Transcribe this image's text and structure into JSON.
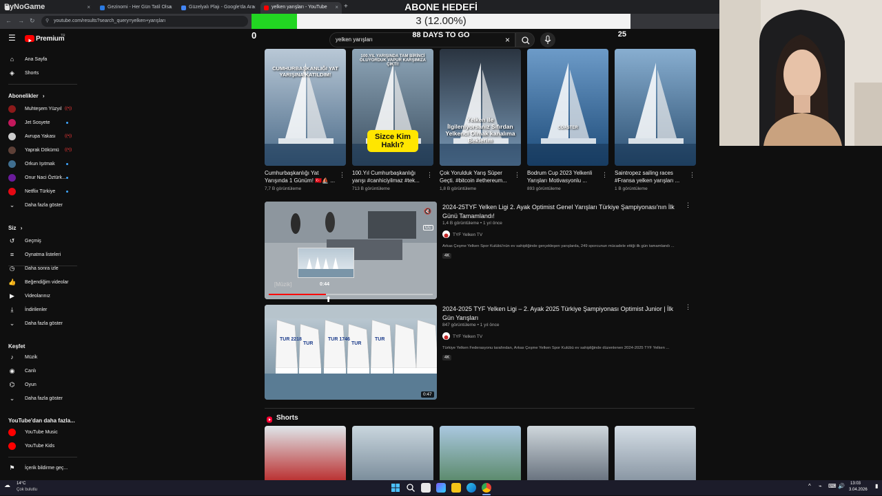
{
  "browser": {
    "tabs": [
      {
        "label": "ByNoGame",
        "color": "#e5e5e5"
      },
      {
        "label": "Gezinomi - Her Gün Tatil Olsa",
        "color": "#2a7ae2"
      },
      {
        "label": "Güzelyalı Plajı - Google'da Ara",
        "color": "#4285f4"
      },
      {
        "label": "yelken yarışları - YouTube",
        "color": "#ff0000"
      }
    ],
    "new_tab": "+",
    "url": "youtube.com/results?search_query=yelken+yarışları"
  },
  "goal": {
    "title": "ABONE HEDEFİ",
    "value_text": "3 (12.00%)",
    "progress_percent": 12,
    "min": "0",
    "max": "25",
    "days": "88 DAYS TO GO"
  },
  "header": {
    "logo": "Premium",
    "logo_sup": "TR",
    "search_value": "yelken yarışları",
    "clear_icon": "×"
  },
  "sidebar": {
    "main": [
      {
        "label": "Ana Sayfa",
        "icon": "⌂"
      },
      {
        "label": "Shorts",
        "icon": "◈"
      }
    ],
    "subs_head": "Abonelikler",
    "subs": [
      {
        "label": "Muhteşem Yüzyıl",
        "color": "#8b1a1a",
        "live": true
      },
      {
        "label": "Jet Sosyete",
        "color": "#c2185b",
        "dot": true
      },
      {
        "label": "Avrupa Yakası",
        "color": "#cccccc",
        "live": true
      },
      {
        "label": "Yaprak Dökümü",
        "color": "#5d4037",
        "live": true
      },
      {
        "label": "Orkun Işıtmak",
        "color": "#3f6e8f",
        "dot": true
      },
      {
        "label": "Onur Naci Öztürk...",
        "color": "#6a1b9a",
        "dot": true
      },
      {
        "label": "Netflix Türkiye",
        "color": "#e50914",
        "dot": true
      },
      {
        "label": "Daha fazla göster",
        "icon": "⌄"
      }
    ],
    "you_head": "Siz",
    "you": [
      {
        "label": "Geçmiş",
        "icon": "↺"
      },
      {
        "label": "Oynatma listeleri",
        "icon": "≡"
      },
      {
        "label": "Daha sonra izle",
        "icon": "◷"
      },
      {
        "label": "Beğendiğim videolar",
        "icon": "👍"
      },
      {
        "label": "Videolarınız",
        "icon": "▶"
      },
      {
        "label": "İndirilenler",
        "icon": "⤓"
      },
      {
        "label": "Daha fazla göster",
        "icon": "⌄"
      }
    ],
    "explore_head": "Keşfet",
    "explore": [
      {
        "label": "Müzik",
        "icon": "♪"
      },
      {
        "label": "Canlı",
        "icon": "◉"
      },
      {
        "label": "Oyun",
        "icon": "⌬"
      },
      {
        "label": "Daha fazla göster",
        "icon": "⌄"
      }
    ],
    "more_head": "YouTube'dan daha fazla...",
    "more": [
      {
        "label": "YouTube Music",
        "color": "#ff0000"
      },
      {
        "label": "YouTube Kids",
        "color": "#ff0000"
      }
    ],
    "report": {
      "label": "İçerik bildirme geç...",
      "icon": "⚑"
    }
  },
  "shorts_row": [
    {
      "title": "Cumhurbaşkanlığı Yat Yarışında 1 Günüm! 🇹🇷⛵ ...",
      "views": "7,7 B görüntüleme",
      "overlay": "CUMHURBAŞKANLIĞI YAT YARIŞINA KATILDIM!",
      "bg1": "#b9c8d6",
      "bg2": "#4a6a88"
    },
    {
      "title": "100.Yıl Cumhurbaşkanlığı yarışı #canhiciyilmaz #tek...",
      "views": "713 B görüntüleme",
      "overlay": "Sizce Kim Haklı?",
      "overlay_top": "100.YIL YARIŞINDA TAM BİRİNCİ OLUYORDUK VAPUR KARŞIMIZA ÇIKTI!",
      "bg1": "#8fa6b8",
      "bg2": "#3a4e60"
    },
    {
      "title": "Çok Yorulduk Yarış Süper Geçti. #bitcoin #ethereum...",
      "views": "1,8 B görüntüleme",
      "overlay": "Yelken ile İlgileniyorsanız Sıfırdan Yelkenci Olmak kanalıma Beklerim",
      "bg1": "#2a3440",
      "bg2": "#7a9ab8"
    },
    {
      "title": "Bodrum Cup 2023 Yelkenli Yarışları Motivasyonlu ...",
      "views": "893 görüntüleme",
      "overlay": "COASTER",
      "bg1": "#6d9bc8",
      "bg2": "#1c4a78"
    },
    {
      "title": "Saintropez sailing races #Fransa yelken yarışları ...",
      "views": "1 B görüntüleme",
      "bg1": "#88aed0",
      "bg2": "#2a4e70"
    }
  ],
  "videos": [
    {
      "title": "2024-25TYF Yelken Ligi 2. Ayak Optimist Genel Yarışları Türkiye Şampiyonası'nın İlk Günü Tamamlandı!",
      "meta": "1,4 B görüntüleme • 1 yıl önce",
      "channel": "TYF Yelken TV",
      "desc": "Arkas Çeşme Yelken Spor Kulübü'nün ev sahipliğinde gerçekleşen yarışlarda, 249 sporcunun mücadele ettiği ilk gün tamamlandı ...",
      "badge": "4K",
      "preview_time": "0:44",
      "caption": "[Müzik]",
      "progress_percent": 35
    },
    {
      "title": "2024-2025 TYF Yelken Ligi – 2. Ayak 2025 Türkiye Şampiyonası Optimist Junior | İlk Gün Yarışları",
      "meta": "847 görüntüleme • 1 yıl önce",
      "channel": "TYF Yelken TV",
      "desc": "Türkiye Yelken Federasyonu tarafından, Arkas Çeşme Yelken Spor Kulübü ev sahipliğinde düzenlenen 2024-2025 TYF Yelken ...",
      "badge": "4K",
      "duration": "0:47",
      "sail_labels": [
        "TUR 2218",
        "TUR",
        "TUR 1746",
        "TUR",
        "TUR"
      ]
    }
  ],
  "shorts_section": {
    "title": "Shorts"
  },
  "shorts_bottom": [
    {
      "bg1": "#dfe6ea",
      "bg2": "#b33"
    },
    {
      "bg1": "#c9d6de",
      "bg2": "#7c8e9c"
    },
    {
      "bg1": "#aac8e0",
      "bg2": "#5d8b6e"
    },
    {
      "bg1": "#cfd7dc",
      "bg2": "#6a7480"
    },
    {
      "bg1": "#d5dee6",
      "bg2": "#8a97a4"
    }
  ],
  "taskbar": {
    "weather_temp": "14°C",
    "weather_desc": "Çok bulutlu",
    "time": "13:03",
    "date": "3.04.2026"
  }
}
